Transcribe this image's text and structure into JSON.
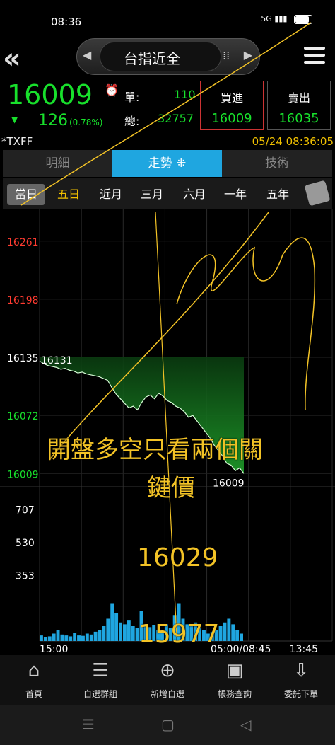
{
  "status": {
    "time": "08:36",
    "network": "5G"
  },
  "header": {
    "title": "台指近全"
  },
  "quote": {
    "price": "16009",
    "change_arrow": "▼",
    "change": "126",
    "change_pct": "(0.78%)",
    "unit_label": "單:",
    "unit_value": "110",
    "total_label": "總:",
    "total_value": "32757",
    "buy_label": "買進",
    "buy_value": "16009",
    "sell_label": "賣出",
    "sell_value": "16035"
  },
  "symbol": "*TXFF",
  "datetime": "05/24 08:36:05",
  "tabs": [
    {
      "label": "明細"
    },
    {
      "label": "走勢 ⁜"
    },
    {
      "label": "技術"
    }
  ],
  "periods": [
    {
      "label": "當日"
    },
    {
      "label": "五日"
    },
    {
      "label": "近月"
    },
    {
      "label": "三月"
    },
    {
      "label": "六月"
    },
    {
      "label": "一年"
    },
    {
      "label": "五年"
    }
  ],
  "chart_data": {
    "type": "area",
    "price_axis": [
      "16261",
      "16198",
      "16135",
      "16072",
      "16009"
    ],
    "price_ylim": [
      16000,
      16280
    ],
    "reference_price": 16135,
    "open_label": "16131",
    "last_label": "16009",
    "volume_axis": [
      "707",
      "530",
      "353"
    ],
    "time_labels": [
      "15:00",
      "05:00/08:45",
      "13:45"
    ],
    "price_series": [
      16131,
      16128,
      16126,
      16125,
      16124,
      16122,
      16123,
      16121,
      16120,
      16118,
      16119,
      16117,
      16116,
      16115,
      16114,
      16112,
      16110,
      16102,
      16095,
      16090,
      16085,
      16080,
      16082,
      16078,
      16086,
      16092,
      16094,
      16090,
      16096,
      16093,
      16088,
      16086,
      16082,
      16080,
      16076,
      16070,
      16072,
      16066,
      16060,
      16054,
      16048,
      16040,
      16034,
      16028,
      16020,
      16018,
      16012,
      16015,
      16009
    ],
    "volume_series": [
      30,
      20,
      25,
      40,
      60,
      35,
      30,
      25,
      45,
      30,
      28,
      40,
      35,
      50,
      60,
      80,
      120,
      200,
      150,
      100,
      90,
      110,
      80,
      70,
      160,
      90,
      75,
      85,
      60,
      55,
      90,
      70,
      140,
      200,
      120,
      90,
      80,
      100,
      70,
      60,
      40,
      50,
      60,
      80,
      100,
      120,
      90,
      60,
      40
    ]
  },
  "annotations": {
    "headline_1": "開盤多空只看兩個關",
    "headline_2": "鍵價",
    "level_1": "16029",
    "level_2": "15977"
  },
  "bottom_nav": [
    {
      "label": "首頁",
      "icon": "home-icon"
    },
    {
      "label": "自選群組",
      "icon": "list-icon"
    },
    {
      "label": "新增自選",
      "icon": "plus-circle-icon"
    },
    {
      "label": "帳務查詢",
      "icon": "account-icon"
    },
    {
      "label": "委託下單",
      "icon": "order-icon"
    }
  ],
  "colors": {
    "up": "#ff3b30",
    "down": "#18e02c",
    "accent": "#1fa6e0",
    "annotation": "#f3c326"
  }
}
